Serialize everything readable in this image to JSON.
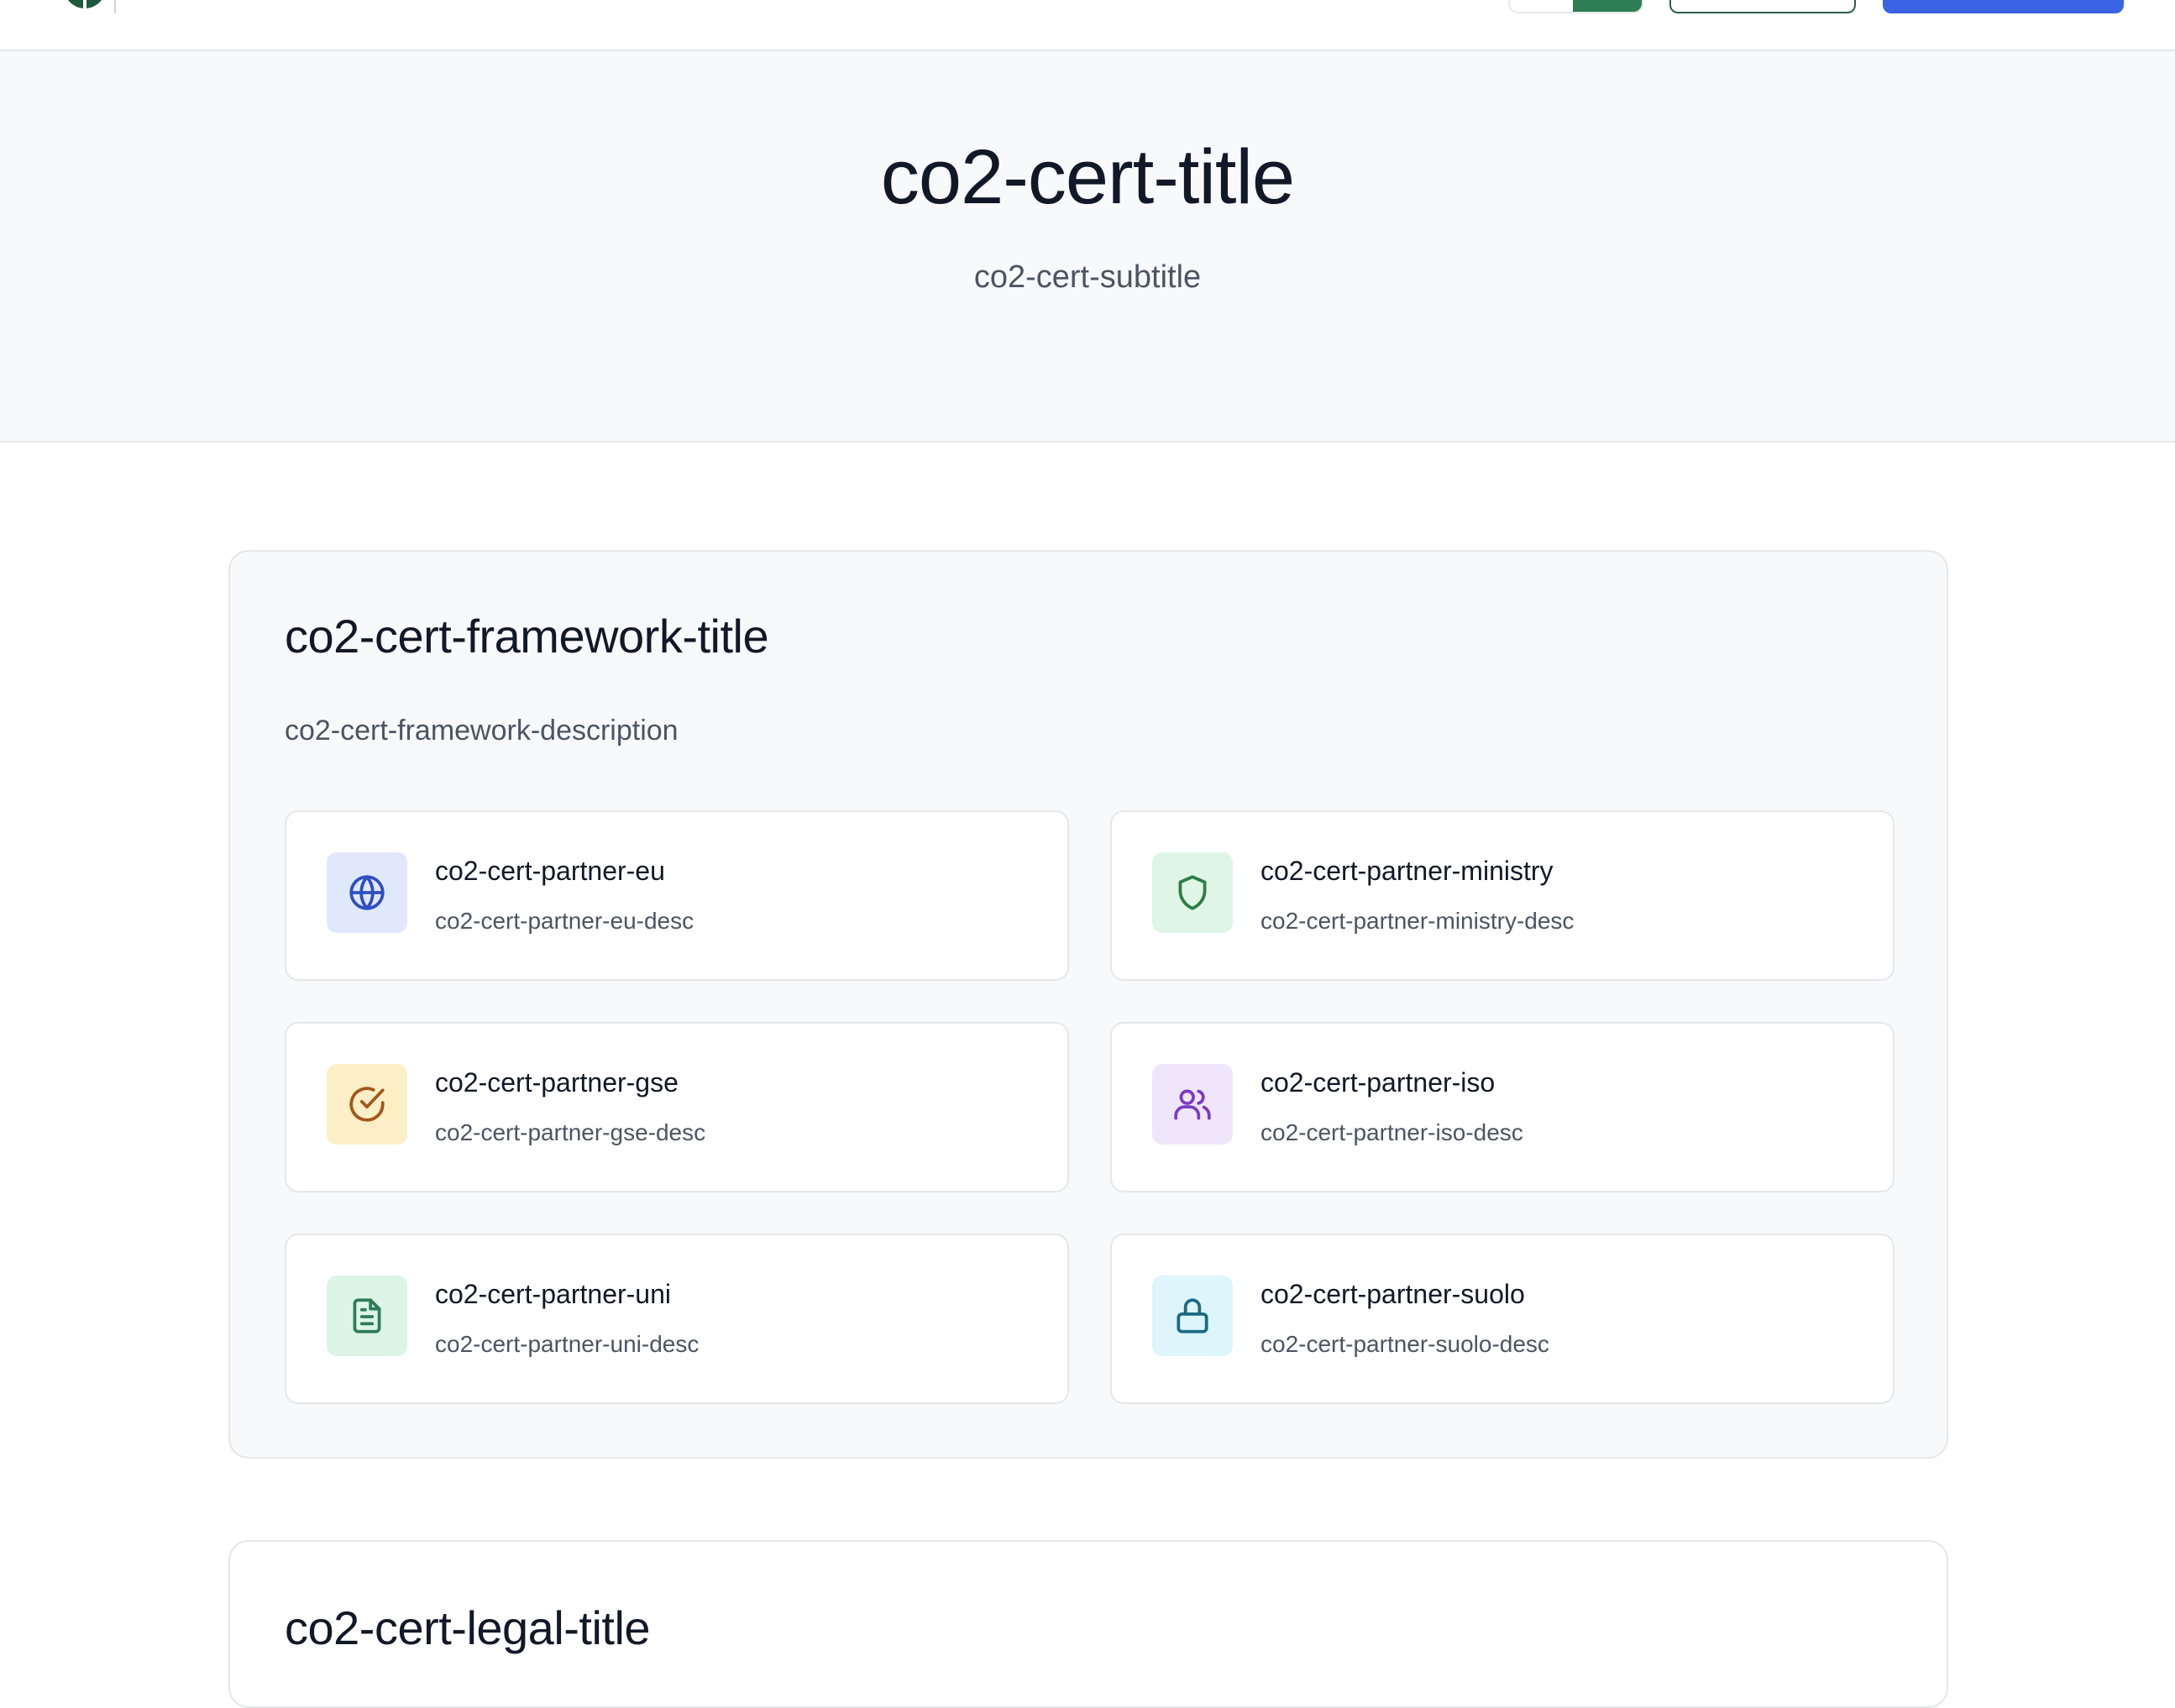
{
  "hero": {
    "title": "co2-cert-title",
    "subtitle": "co2-cert-subtitle"
  },
  "framework": {
    "title": "co2-cert-framework-title",
    "description": "co2-cert-framework-description",
    "partners": [
      {
        "title": "co2-cert-partner-eu",
        "desc": "co2-cert-partner-eu-desc",
        "icon": "globe-icon",
        "icon_color": "#2f4fc2",
        "bg_color": "#e0e8fb"
      },
      {
        "title": "co2-cert-partner-ministry",
        "desc": "co2-cert-partner-ministry-desc",
        "icon": "shield-icon",
        "icon_color": "#2e7d45",
        "bg_color": "#dff5e6"
      },
      {
        "title": "co2-cert-partner-gse",
        "desc": "co2-cert-partner-gse-desc",
        "icon": "check-circle-icon",
        "icon_color": "#a5561b",
        "bg_color": "#fcefc8"
      },
      {
        "title": "co2-cert-partner-iso",
        "desc": "co2-cert-partner-iso-desc",
        "icon": "users-icon",
        "icon_color": "#7b3cc4",
        "bg_color": "#f0e6fb"
      },
      {
        "title": "co2-cert-partner-uni",
        "desc": "co2-cert-partner-uni-desc",
        "icon": "document-icon",
        "icon_color": "#2e7d54",
        "bg_color": "#dcf5e6"
      },
      {
        "title": "co2-cert-partner-suolo",
        "desc": "co2-cert-partner-suolo-desc",
        "icon": "lock-icon",
        "icon_color": "#1d6a80",
        "bg_color": "#dcf6fb"
      }
    ]
  },
  "legal": {
    "title": "co2-cert-legal-title"
  },
  "colors": {
    "brand_green": "#2e7d54",
    "primary_blue": "#3b63e6",
    "page_bg": "#f8f9fb",
    "border": "#e5e7eb"
  }
}
